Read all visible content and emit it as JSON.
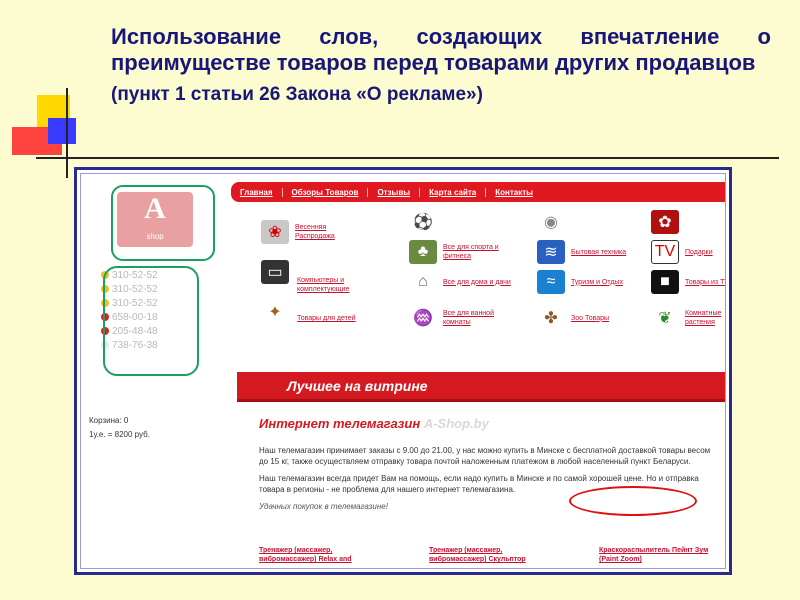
{
  "slide": {
    "title": "Использование слов, создающих впечатление о преимуществе товаров перед товарами других продавцов",
    "subtitle": "(пункт 1 статьи 26 Закона «О рекламе»)"
  },
  "site": {
    "nav": [
      "Главная",
      "Обзоры Товаров",
      "Отзывы",
      "Карта сайта",
      "Контакты"
    ],
    "logo": {
      "letter": "A",
      "text": "shop"
    },
    "phones": [
      "310-52-52",
      "310-52-52",
      "310-52-52",
      "658-00-18",
      "205-48-48",
      "738-76-38"
    ],
    "cart": {
      "label": "Корзина: 0",
      "rate": "1у.е. = 8200 руб."
    },
    "categories": [
      {
        "label": "Весенняя Распродажа",
        "icon": "gift-icon"
      },
      {
        "label": "Все для спорта и фитнеса",
        "icon": "ball-icon"
      },
      {
        "label": "Бытовая техника",
        "icon": "washer-icon"
      },
      {
        "label": "Подарки",
        "icon": "present-icon"
      },
      {
        "label": "Компьютеры и комплектующие",
        "icon": "laptop-icon"
      },
      {
        "label": "Все для дома и дачи",
        "icon": "house-icon"
      },
      {
        "label": "Туризм и Отдых",
        "icon": "fins-icon"
      },
      {
        "label": "Товары из TV SHOP",
        "icon": "tv-icon"
      },
      {
        "label": "Товары для детей",
        "icon": "teddy-icon"
      },
      {
        "label": "Все для ванной комнаты",
        "icon": "tap-icon"
      },
      {
        "label": "Зоо Товары",
        "icon": "pets-icon"
      },
      {
        "label": "Комнатные растения",
        "icon": "plant-icon"
      }
    ],
    "banner": "Лучшее на витрине",
    "main": {
      "heading": "Интернет телемагазин",
      "heading_blur": "A-Shop.by",
      "p1": "Наш телемагазин принимает заказы с 9.00 до 21.00, у нас можно купить в Минске с бесплатной доставкой товары весом до 15 кг, также осуществляем отправку товара почтой наложенным платежом в любой населенный пункт Беларуси.",
      "p2": "Наш телемагазин всегда придет Вам на помощь, если надо купить в Минске и по самой хорошей цене. Но и отправка товара в регионы - не проблема для нашего интернет телемагазина.",
      "note": "Удачных покупок в телемагазине!"
    },
    "products": [
      "Тренажер (массажер, вибромассажер) Relax and",
      "Тренажер (массажер, вибромассажер) Скульптор",
      "Краскораспылитель Пейнт Зум (Paint Zoom)"
    ]
  }
}
